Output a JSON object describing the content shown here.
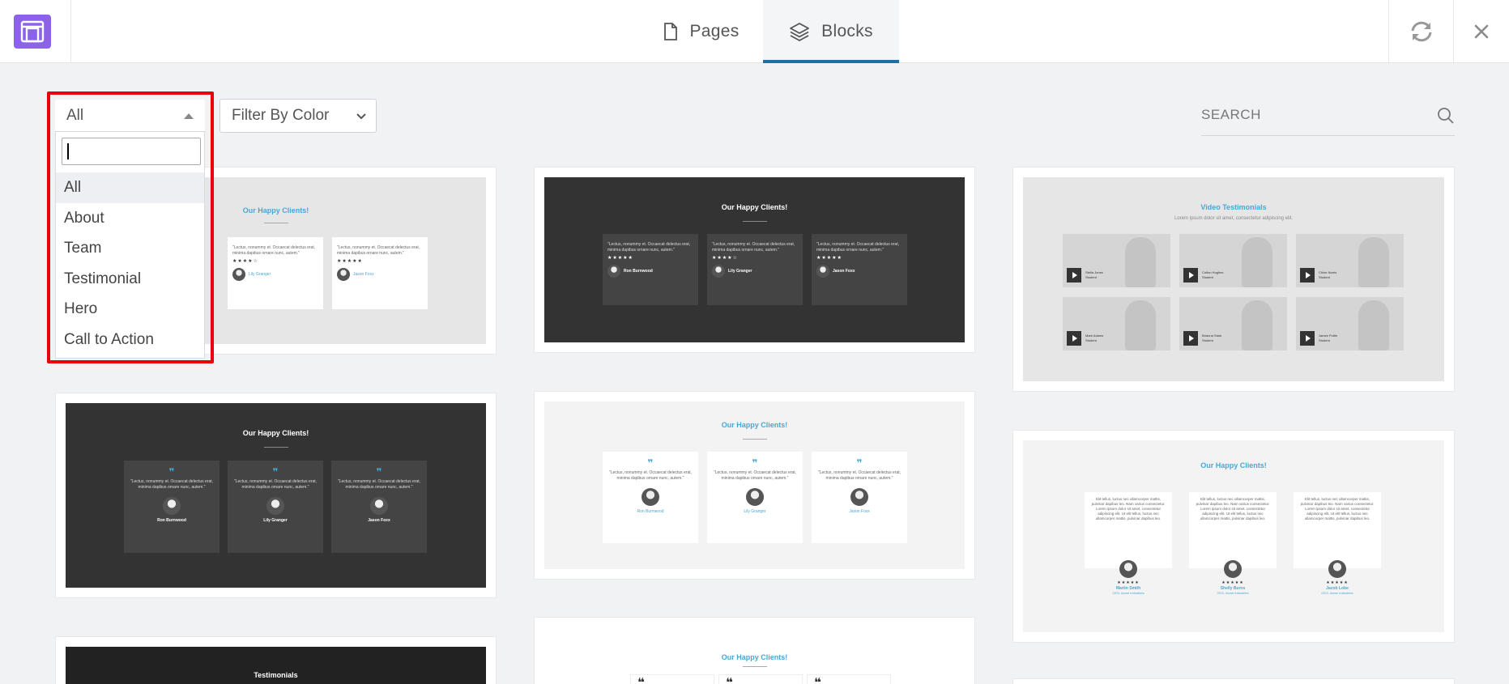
{
  "topbar": {
    "tabs": [
      {
        "label": "Pages",
        "icon": "file-icon"
      },
      {
        "label": "Blocks",
        "icon": "layers-icon",
        "active": true
      }
    ],
    "accent": "#1e6ea8",
    "logo_color": "#8b62e8"
  },
  "filters": {
    "category_selected": "All",
    "color_placeholder": "Filter By Color",
    "search_placeholder": "SEARCH"
  },
  "dropdown": {
    "search_value": "",
    "options": [
      "All",
      "About",
      "Team",
      "Testimonial",
      "Hero",
      "Call to Action"
    ],
    "selected": "All",
    "highlight_color": "#e8000b"
  },
  "cards": {
    "c1": {
      "title": "Our Happy Clients!",
      "items": [
        {
          "text": "\"Lectus, nonummy et. Occaecat delectus erat, minima dapibus ornare nunc, autem.\"",
          "stars": "★★★★☆",
          "name": "Lily Granger"
        },
        {
          "text": "\"Lectus, nonummy et. Occaecat delectus erat, minima dapibus ornare nunc, autem.\"",
          "stars": "★★★★★",
          "name": "Jason Foxx"
        }
      ]
    },
    "c2": {
      "title": "Our Happy Clients!",
      "items": [
        {
          "text": "\"Lectus, nonummy et. Occaecat delectus erat, minima dapibus ornare nunc, autem.\"",
          "stars": "★★★★★",
          "name": "Ron Burnwood"
        },
        {
          "text": "\"Lectus, nonummy et. Occaecat delectus erat, minima dapibus ornare nunc, autem.\"",
          "stars": "★★★★☆",
          "name": "Lily Granger"
        },
        {
          "text": "\"Lectus, nonummy et. Occaecat delectus erat, minima dapibus ornare nunc, autem.\"",
          "stars": "★★★★★",
          "name": "Jason Foxx"
        }
      ]
    },
    "c3": {
      "title": "Video Testimonials",
      "subtitle": "Lorem ipsum dolor sit amet, consectetur adipiscing elit.",
      "people": [
        {
          "name": "Stella Jones",
          "role": "Student"
        },
        {
          "name": "Colton Hughes",
          "role": "Student"
        },
        {
          "name": "Chloe Norris",
          "role": "Student"
        },
        {
          "name": "Mark Adams",
          "role": "Student"
        },
        {
          "name": "Brianna Stark",
          "role": "Student"
        },
        {
          "name": "James Pottle",
          "role": "Student"
        }
      ]
    },
    "c4": {
      "title": "Our Happy Clients!",
      "items": [
        {
          "text": "\"Lectus, nonummy et. Occaecat delectus erat, minima dapibus ornare nunc, autem.\"",
          "name": "Ron Burnwood"
        },
        {
          "text": "\"Lectus, nonummy et. Occaecat delectus erat, minima dapibus ornare nunc, autem.\"",
          "name": "Lily Granger"
        },
        {
          "text": "\"Lectus, nonummy et. Occaecat delectus erat, minima dapibus ornare nunc, autem.\"",
          "name": "Jason Foxx"
        }
      ]
    },
    "c5": {
      "title": "Our Happy Clients!",
      "items": [
        {
          "text": "\"Lectus, nonummy et. Occaecat delectus erat, minima dapibus ornare nunc, autem.\"",
          "name": "Ron Burnwood"
        },
        {
          "text": "\"Lectus, nonummy et. Occaecat delectus erat, minima dapibus ornare nunc, autem.\"",
          "name": "Lily Granger"
        },
        {
          "text": "\"Lectus, nonummy et. Occaecat delectus erat, minima dapibus ornare nunc, autem.\"",
          "name": "Jason Foxx"
        }
      ]
    },
    "c6": {
      "title": "Our Happy Clients!",
      "items": [
        {
          "text": "Elit tellus, luctus nec ullamcorper mattis, pulvinar dapibus leo. Nam varius consectetur. Lorem ipsum dolor sit amet, consectetur adipiscing elit. Ut elit tellus, luctus nec ullamcorper mattis, pulvinar dapibus leo.",
          "stars": "★★★★★",
          "name": "Martin Smith",
          "role": "CEO, Acme Industries"
        },
        {
          "text": "Elit tellus, luctus nec ullamcorper mattis, pulvinar dapibus leo. Nam varius consectetur. Lorem ipsum dolor sit amet, consectetur adipiscing elit. Ut elit tellus, luctus nec ullamcorper mattis, pulvinar dapibus leo.",
          "stars": "★★★★★",
          "name": "Shelly Burns",
          "role": "CEO, Acme Industries"
        },
        {
          "text": "Elit tellus, luctus nec ullamcorper mattis, pulvinar dapibus leo. Nam varius consectetur. Lorem ipsum dolor sit amet, consectetur adipiscing elit. Ut elit tellus, luctus nec ullamcorper mattis, pulvinar dapibus leo.",
          "stars": "★★★★★",
          "name": "Jacob Lobe",
          "role": "CEO, Acme Industries"
        }
      ]
    },
    "c7": {
      "title": "Testimonials"
    },
    "c8": {
      "title": "Our Happy Clients!"
    }
  }
}
